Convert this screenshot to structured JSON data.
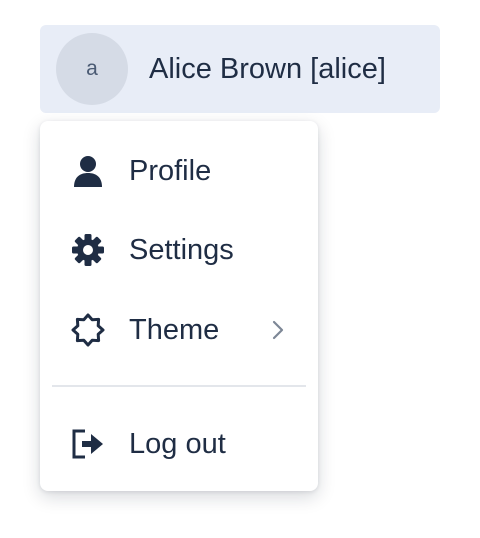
{
  "user": {
    "avatar_initial": "a",
    "display_name": "Alice Brown [alice]"
  },
  "menu": {
    "items": [
      {
        "label": "Profile",
        "icon": "user-icon"
      },
      {
        "label": "Settings",
        "icon": "gear-icon"
      },
      {
        "label": "Theme",
        "icon": "theme-sun-icon",
        "has_submenu": true
      },
      {
        "label": "Log out",
        "icon": "logout-icon"
      }
    ]
  },
  "colors": {
    "text": "#1f2d44",
    "user_button_bg": "#e8edf7",
    "avatar_bg": "#d5dbe6",
    "divider": "#e3e6eb"
  }
}
